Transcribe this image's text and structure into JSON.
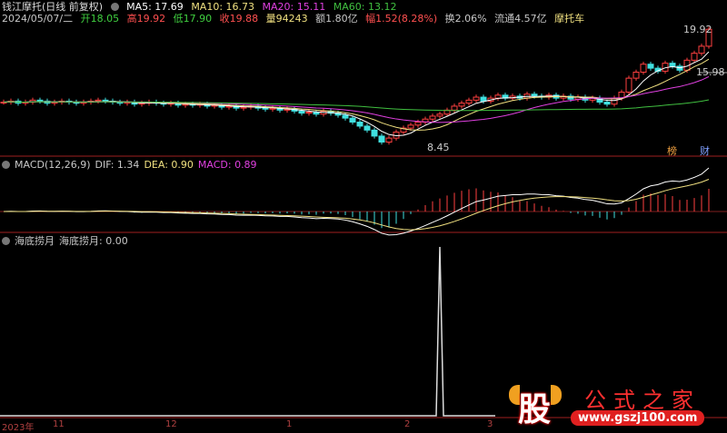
{
  "header": {
    "title": "钱江摩托(日线 前复权)",
    "ma5": "MA5: 17.69",
    "ma10": "MA10: 16.73",
    "ma20": "MA20: 15.11",
    "ma60": "MA60: 13.12"
  },
  "quote": {
    "date": "2024/05/07/二",
    "open": "开18.05",
    "high": "高19.92",
    "low": "低17.90",
    "close": "收19.88",
    "volume": "量94243",
    "amount": "额1.80亿",
    "change": "幅1.52(8.28%)",
    "turnover": "换2.06%",
    "float": "流通4.57亿",
    "sector": "摩托车"
  },
  "price_labels": {
    "high": "19.92",
    "low": "8.45",
    "mid": "15.98",
    "tag1": "榜",
    "tag2": "财"
  },
  "macd": {
    "title": "MACD(12,26,9)",
    "dif": "DIF: 1.34",
    "dea": "DEA: 0.90",
    "macd": "MACD: 0.89"
  },
  "indicator": {
    "title": "海底捞月",
    "value": "海底捞月: 0.00",
    "signal_index": 60
  },
  "axis": {
    "labels": [
      "2023年",
      "11",
      "12",
      "1",
      "2",
      "3"
    ]
  },
  "logo": {
    "char": "股",
    "name": "公式之家",
    "url": "www.gszj100.com"
  },
  "colors": {
    "up": "#ff4040",
    "down": "#40e0e0",
    "ma5": "#ffffff",
    "ma10": "#f0e080",
    "ma20": "#e040e0",
    "ma60": "#40c040",
    "grid": "#a02020"
  },
  "chart_data": {
    "type": "candlestick",
    "closes": [
      12.6,
      12.7,
      12.5,
      12.6,
      12.8,
      12.7,
      12.5,
      12.6,
      12.7,
      12.6,
      12.5,
      12.6,
      12.7,
      12.8,
      12.7,
      12.6,
      12.5,
      12.6,
      12.4,
      12.5,
      12.6,
      12.5,
      12.4,
      12.5,
      12.3,
      12.4,
      12.3,
      12.4,
      12.2,
      12.3,
      12.1,
      12.2,
      12.0,
      12.1,
      12.2,
      12.0,
      11.9,
      12.0,
      11.8,
      11.9,
      11.7,
      11.5,
      11.6,
      11.4,
      11.7,
      11.5,
      11.3,
      11.0,
      10.6,
      10.2,
      9.8,
      9.2,
      8.6,
      9.0,
      9.6,
      10.0,
      10.3,
      10.6,
      10.9,
      11.2,
      11.4,
      11.8,
      12.2,
      12.5,
      12.8,
      13.1,
      12.7,
      13.0,
      13.3,
      13.0,
      13.2,
      13.0,
      13.4,
      13.2,
      13.1,
      13.3,
      13.0,
      13.2,
      12.9,
      13.1,
      12.8,
      13.0,
      12.6,
      12.4,
      13.0,
      13.6,
      15.0,
      15.6,
      16.4,
      16.0,
      15.7,
      16.5,
      16.2,
      15.8,
      16.8,
      17.5,
      18.2,
      19.9
    ]
  }
}
